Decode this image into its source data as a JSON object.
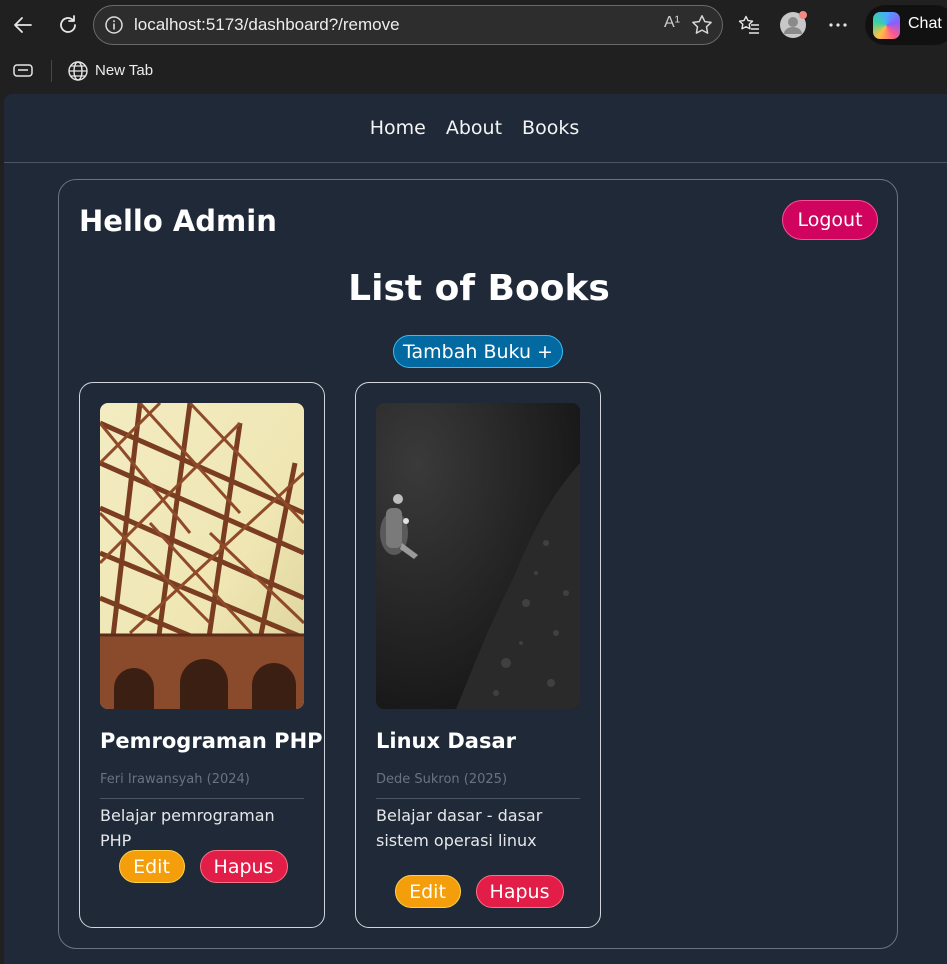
{
  "browser": {
    "url": "localhost:5173/dashboard?/remove",
    "read_aloud_label": "A¹",
    "copilot_label": "Chat",
    "bookmark_label": "New Tab",
    "icons": [
      "back-arrow-icon",
      "refresh-icon",
      "info-icon",
      "read-aloud-icon",
      "favorite-star-icon",
      "favorites-list-icon",
      "profile-avatar-icon",
      "more-icon",
      "copilot-icon",
      "tab-actions-icon",
      "globe-icon"
    ]
  },
  "nav": {
    "items": [
      {
        "label": "Home"
      },
      {
        "label": "About"
      },
      {
        "label": "Books"
      }
    ]
  },
  "dashboard": {
    "greeting": "Hello Admin",
    "logout_label": "Logout",
    "section_title": "List of Books",
    "add_button_label": "Tambah Buku +"
  },
  "books": [
    {
      "title": "Pemrograman PHP",
      "meta": "Feri Irawansyah (2024)",
      "description": "Belajar pemrograman PHP",
      "edit_label": "Edit",
      "delete_label": "Hapus"
    },
    {
      "title": "Linux Dasar",
      "meta": "Dede Sukron (2025)",
      "description": "Belajar dasar - dasar sistem operasi linux",
      "edit_label": "Edit",
      "delete_label": "Hapus"
    }
  ],
  "colors": {
    "page_bg": "#1f2937",
    "logout": "#d0045f",
    "add": "#0369a1",
    "edit": "#f59e0b",
    "delete": "#e11d48"
  }
}
